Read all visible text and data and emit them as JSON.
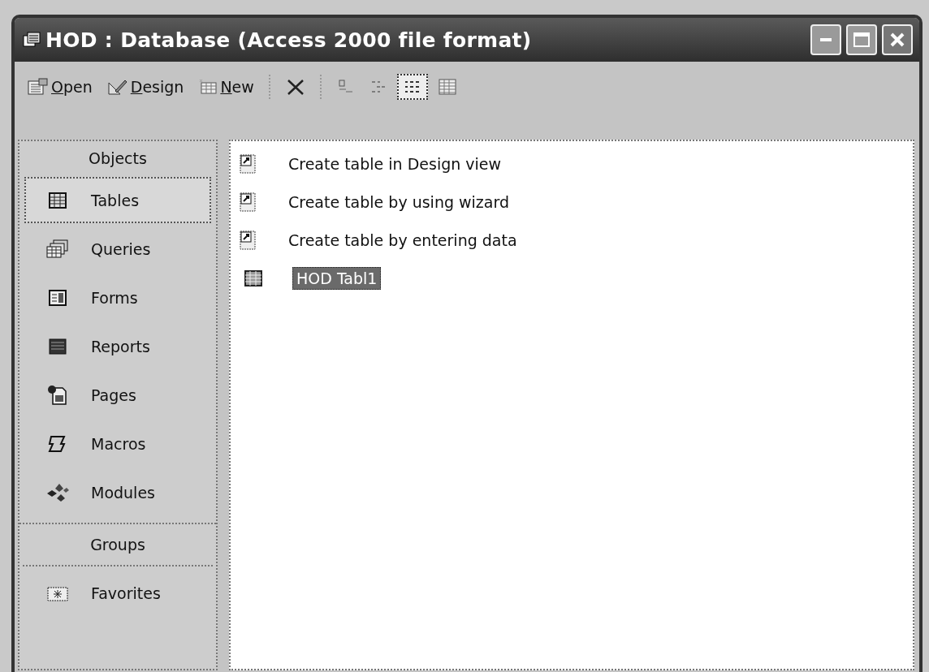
{
  "window": {
    "title": "HOD : Database (Access 2000 file format)"
  },
  "toolbar": {
    "commands": [
      {
        "label": "Open",
        "underline_first": true
      },
      {
        "label": "Design",
        "underline_first": true
      },
      {
        "label": "New",
        "underline_first": true
      }
    ],
    "views": [
      {
        "selected": false
      },
      {
        "selected": false
      },
      {
        "selected": true
      },
      {
        "selected": false
      }
    ]
  },
  "sidebar": {
    "sections": [
      {
        "title": "Objects",
        "items": [
          {
            "label": "Tables",
            "selected": true
          },
          {
            "label": "Queries",
            "selected": false
          },
          {
            "label": "Forms",
            "selected": false
          },
          {
            "label": "Reports",
            "selected": false
          },
          {
            "label": "Pages",
            "selected": false
          },
          {
            "label": "Macros",
            "selected": false
          },
          {
            "label": "Modules",
            "selected": false
          }
        ]
      },
      {
        "title": "Groups",
        "items": [
          {
            "label": "Favorites",
            "selected": false
          }
        ]
      }
    ]
  },
  "list": {
    "items": [
      {
        "kind": "shortcut",
        "label": "Create table in Design view",
        "selected": false
      },
      {
        "kind": "shortcut",
        "label": "Create table by using wizard",
        "selected": false
      },
      {
        "kind": "shortcut",
        "label": "Create table by entering data",
        "selected": false
      },
      {
        "kind": "table",
        "label": "HOD Tabl1",
        "selected": true
      }
    ]
  }
}
